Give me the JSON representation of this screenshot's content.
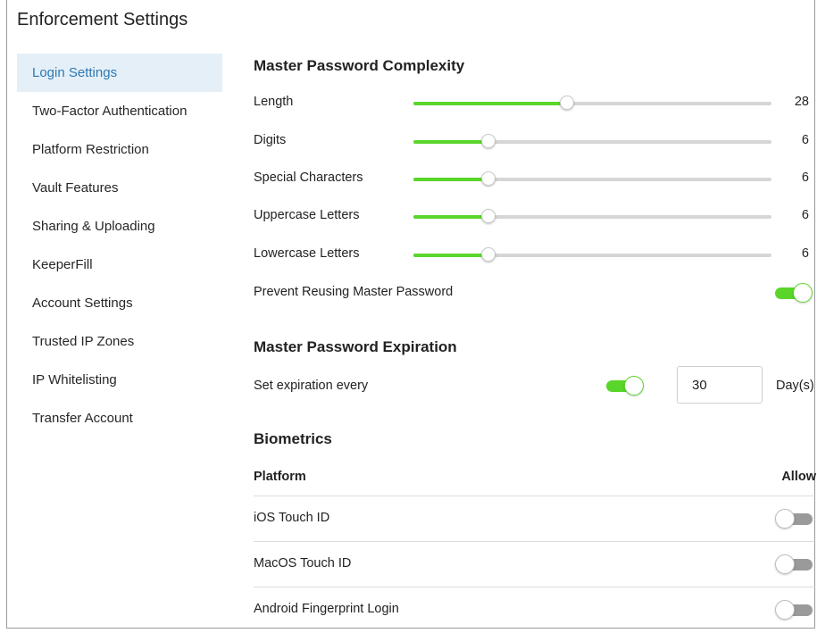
{
  "window": {
    "title": "Enforcement Settings"
  },
  "sidebar": {
    "items": [
      {
        "label": "Login Settings",
        "active": true
      },
      {
        "label": "Two-Factor Authentication",
        "active": false
      },
      {
        "label": "Platform Restriction",
        "active": false
      },
      {
        "label": "Vault Features",
        "active": false
      },
      {
        "label": "Sharing & Uploading",
        "active": false
      },
      {
        "label": "KeeperFill",
        "active": false
      },
      {
        "label": "Account Settings",
        "active": false
      },
      {
        "label": "Trusted IP Zones",
        "active": false
      },
      {
        "label": "IP Whitelisting",
        "active": false
      },
      {
        "label": "Transfer Account",
        "active": false
      }
    ]
  },
  "complexity": {
    "title": "Master Password Complexity",
    "sliders": [
      {
        "label": "Length",
        "value": "28",
        "level": 0.43
      },
      {
        "label": "Digits",
        "value": "6",
        "level": 0.21
      },
      {
        "label": "Special Characters",
        "value": "6",
        "level": 0.21
      },
      {
        "label": "Uppercase Letters",
        "value": "6",
        "level": 0.21
      },
      {
        "label": "Lowercase Letters",
        "value": "6",
        "level": 0.21
      }
    ],
    "prevent_reuse": {
      "label": "Prevent Reusing Master Password",
      "enabled": true
    }
  },
  "expiration": {
    "title": "Master Password Expiration",
    "label": "Set expiration every",
    "enabled": true,
    "days_value": "30",
    "unit": "Day(s)"
  },
  "biometrics": {
    "title": "Biometrics",
    "col_platform": "Platform",
    "col_allow": "Allow",
    "rows": [
      {
        "label": "iOS Touch ID",
        "allowed": false
      },
      {
        "label": "MacOS Touch ID",
        "allowed": false
      },
      {
        "label": "Android Fingerprint Login",
        "allowed": false
      }
    ]
  },
  "colors": {
    "accent_green": "#5ad62a",
    "active_nav_bg": "#e5eff7",
    "active_nav_text": "#2d79b3"
  }
}
